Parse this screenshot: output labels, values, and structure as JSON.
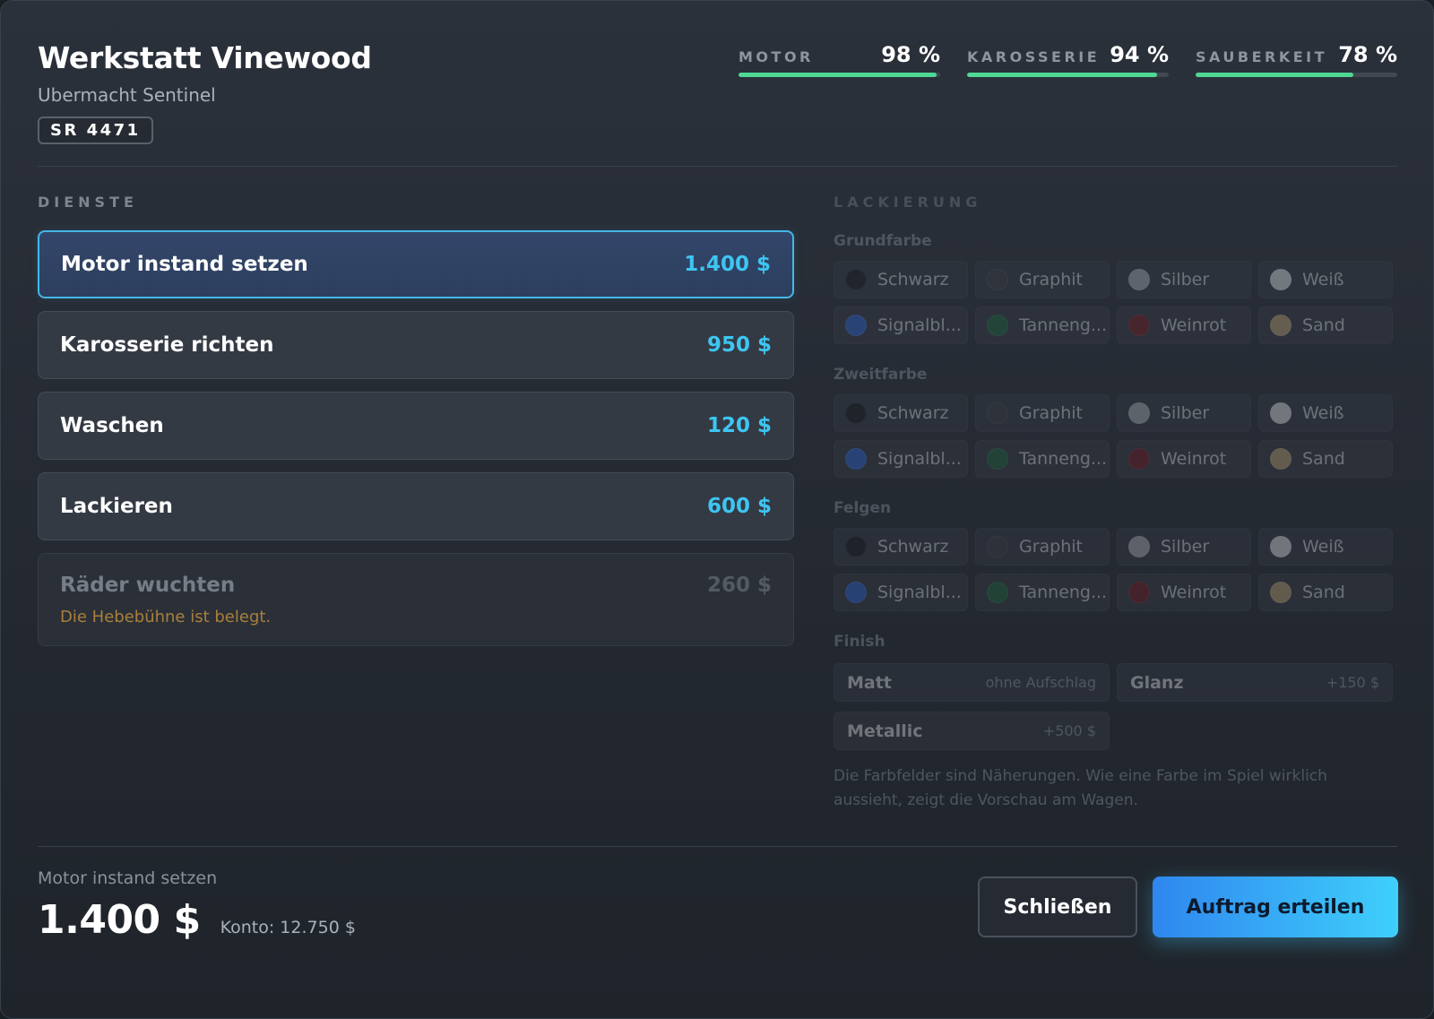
{
  "header": {
    "title": "Werkstatt Vinewood",
    "vehicle": "Ubermacht Sentinel",
    "plate": "SR 4471"
  },
  "stats": [
    {
      "label": "MOTOR",
      "value": "98 %",
      "level": 0.98
    },
    {
      "label": "KAROSSERIE",
      "value": "94 %",
      "level": 0.94
    },
    {
      "label": "SAUBERKEIT",
      "value": "78 %",
      "level": 0.78
    }
  ],
  "services": {
    "title": "DIENSTE",
    "items": [
      {
        "name": "Motor instand setzen",
        "price": "1.400 $",
        "selected": true
      },
      {
        "name": "Karosserie richten",
        "price": "950 $"
      },
      {
        "name": "Waschen",
        "price": "120 $"
      },
      {
        "name": "Lackieren",
        "price": "600 $"
      },
      {
        "name": "Räder wuchten",
        "price": "260 $",
        "disabled": true,
        "note": "Die Hebebühne ist belegt."
      }
    ]
  },
  "paint": {
    "title": "LACKIERUNG",
    "groups": [
      {
        "label": "Grundfarbe"
      },
      {
        "label": "Zweitfarbe"
      },
      {
        "label": "Felgen"
      }
    ],
    "colors": [
      {
        "name": "Schwarz",
        "hex": "#16191f"
      },
      {
        "name": "Graphit",
        "hex": "#3a3f47"
      },
      {
        "name": "Silber",
        "hex": "#b9bec6"
      },
      {
        "name": "Weiß",
        "hex": "#f0f2f5"
      },
      {
        "name": "Signalbl...",
        "hex": "#2d6ae0"
      },
      {
        "name": "Tanneng...",
        "hex": "#1f6b40"
      },
      {
        "name": "Weinrot",
        "hex": "#7a1a22"
      },
      {
        "name": "Sand",
        "hex": "#c9ae7c"
      }
    ],
    "finish_label": "Finish",
    "finishes": [
      {
        "name": "Matt",
        "extra": "ohne Aufschlag"
      },
      {
        "name": "Glanz",
        "extra": "+150 $"
      },
      {
        "name": "Metallic",
        "extra": "+500 $"
      }
    ],
    "note": "Die Farbfelder sind Näherungen. Wie eine Farbe im Spiel wirklich aussieht, zeigt die Vorschau am Wagen."
  },
  "footer": {
    "selected_service": "Motor instand setzen",
    "total": "1.400 $",
    "balance": "Konto: 12.750 $",
    "close_label": "Schließen",
    "submit_label": "Auftrag erteilen"
  }
}
